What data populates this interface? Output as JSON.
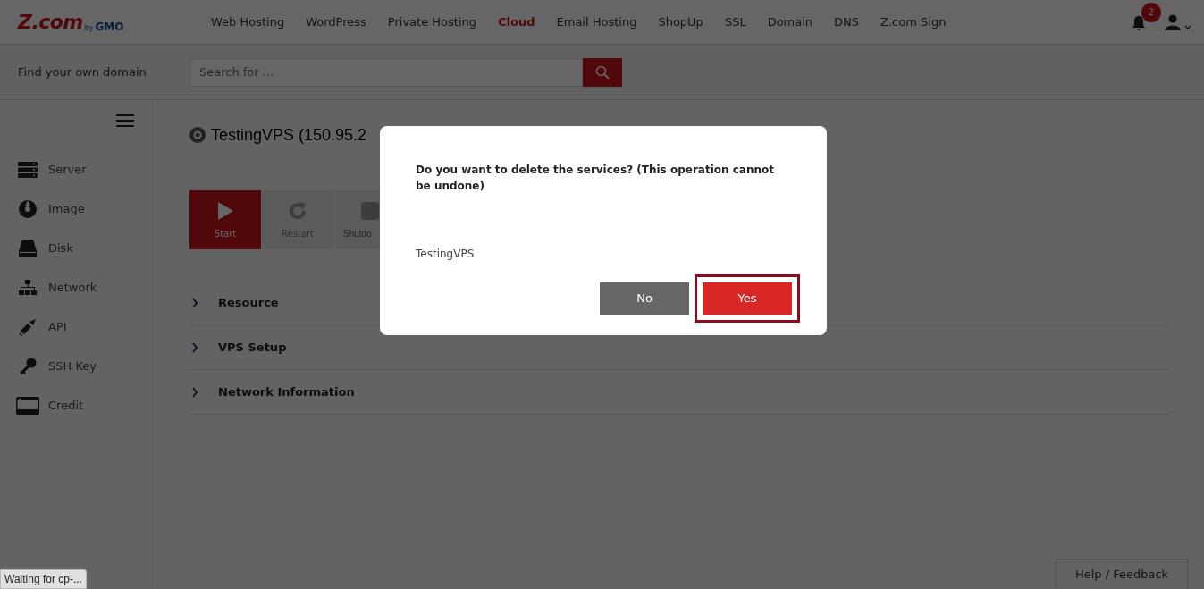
{
  "header": {
    "logo": {
      "main": "Z.com",
      "by": "by",
      "brand": "GMO"
    },
    "nav": [
      {
        "label": "Web Hosting",
        "selected": false
      },
      {
        "label": "WordPress",
        "selected": false
      },
      {
        "label": "Private Hosting",
        "selected": false
      },
      {
        "label": "Cloud",
        "selected": true
      },
      {
        "label": "Email Hosting",
        "selected": false
      },
      {
        "label": "ShopUp",
        "selected": false
      },
      {
        "label": "SSL",
        "selected": false
      },
      {
        "label": "Domain",
        "selected": false
      },
      {
        "label": "DNS",
        "selected": false
      },
      {
        "label": "Z.com Sign",
        "selected": false
      }
    ],
    "notifications": "2"
  },
  "search_bar": {
    "label": "Find your own domain",
    "placeholder": "Search for ..."
  },
  "sidebar": {
    "items": [
      {
        "kind": "server",
        "label": "Server"
      },
      {
        "kind": "image",
        "label": "Image"
      },
      {
        "kind": "disk",
        "label": "Disk"
      },
      {
        "kind": "network",
        "label": "Network"
      },
      {
        "kind": "api",
        "label": "API"
      },
      {
        "kind": "key",
        "label": "SSH Key"
      },
      {
        "kind": "credit",
        "label": "Credit"
      }
    ]
  },
  "main": {
    "title": "TestingVPS (150.95.2",
    "actions": [
      {
        "kind": "start",
        "label": "Start",
        "disabled": false
      },
      {
        "kind": "restart",
        "label": "Restart",
        "disabled": true
      },
      {
        "kind": "shutdown",
        "label": "Shutdo",
        "disabled": true
      }
    ],
    "sections": [
      {
        "label": "Resource",
        "expanded": false
      },
      {
        "label": "VPS Setup",
        "expanded": false
      },
      {
        "label": "Network Information",
        "expanded": false
      }
    ]
  },
  "dialog": {
    "message": "Do you want to delete the services? (This operation cannot be undone)",
    "item": "TestingVPS",
    "buttons": [
      {
        "kind": "cancel",
        "label": "No",
        "highlighted": false
      },
      {
        "kind": "confirm",
        "label": "Yes",
        "highlighted": true
      }
    ]
  },
  "help_button": "Help / Feedback",
  "status_bar": "Waiting for cp-..."
}
